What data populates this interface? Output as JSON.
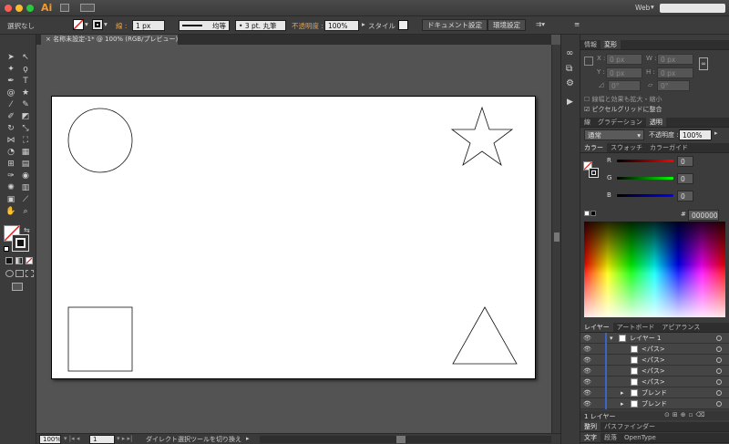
{
  "titlebar": {
    "app_logo": "Ai",
    "workspace": "Web"
  },
  "control": {
    "selection_label": "選択なし",
    "stroke_label": "線 :",
    "stroke_width": "1 px",
    "profile": "均等",
    "brush": "3 pt. 丸筆",
    "opacity_label": "不透明度 :",
    "opacity_value": "100%",
    "style_label": "スタイル :",
    "doc_setup_button": "ドキュメント設定",
    "prefs_button": "環境設定"
  },
  "document": {
    "tab_title": "名称未設定-1* @ 100% (RGB/プレビュー)"
  },
  "status": {
    "zoom": "100%",
    "page": "1",
    "message": "ダイレクト選択ツールを切り換え"
  },
  "info_panel": {
    "tabs": [
      "情報",
      "変形"
    ],
    "x_label": "X :",
    "x_value": "0 px",
    "y_label": "Y :",
    "y_value": "0 px",
    "w_label": "W :",
    "w_value": "0 px",
    "h_label": "H :",
    "h_value": "0 px",
    "angle_value": "0°",
    "shear_value": "0°",
    "scale_strokes": "線幅と効果も拡大・縮小",
    "pixel_grid": "ピクセルグリッドに整合"
  },
  "transparency_panel": {
    "tabs": [
      "線",
      "グラデーション",
      "透明"
    ],
    "mode": "通常",
    "opacity_label": "不透明度 :",
    "opacity_value": "100%"
  },
  "color_panel": {
    "tabs": [
      "カラー",
      "スウォッチ",
      "カラーガイド"
    ],
    "r_label": "R",
    "r_value": "0",
    "g_label": "G",
    "g_value": "0",
    "b_label": "B",
    "b_value": "0",
    "hex_label": "#",
    "hex_value": "000000"
  },
  "layers_panel": {
    "tabs": [
      "レイヤー",
      "アートボード",
      "アピアランス"
    ],
    "rows": [
      {
        "name": "レイヤー 1",
        "level": 0
      },
      {
        "name": "<パス>",
        "level": 1
      },
      {
        "name": "<パス>",
        "level": 1
      },
      {
        "name": "<パス>",
        "level": 1
      },
      {
        "name": "<パス>",
        "level": 1
      },
      {
        "name": "ブレンド",
        "level": 1
      },
      {
        "name": "ブレンド",
        "level": 1
      }
    ],
    "footer": "1 レイヤー"
  },
  "bottom_panels": {
    "tabs1": [
      "整列",
      "パスファインダー"
    ],
    "tabs2": [
      "文字",
      "段落",
      "OpenType"
    ]
  },
  "colors": {
    "accent_orange": "#f0a040",
    "layer_bar": "#3a64c8"
  }
}
